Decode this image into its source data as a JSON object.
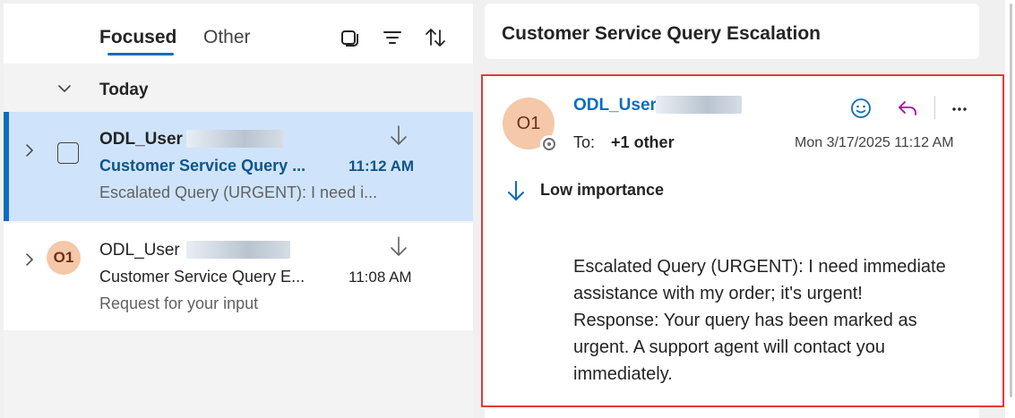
{
  "list": {
    "tabs": [
      {
        "label": "Focused"
      },
      {
        "label": "Other"
      }
    ],
    "icons": [
      "select-mode-icon",
      "filter-icon",
      "sort-icon"
    ],
    "group": {
      "label": "Today"
    },
    "messages": [
      {
        "sender": "ODL_User",
        "subject": "Customer Service Query ...",
        "time": "11:12 AM",
        "preview": "Escalated Query (URGENT): I need i...",
        "selected": true,
        "unread": true
      },
      {
        "sender": "ODL_User",
        "avatar": "O1",
        "subject": "Customer Service Query E...",
        "time": "11:08 AM",
        "preview": "Request for your input",
        "selected": false,
        "unread": false
      }
    ]
  },
  "reading": {
    "subject": "Customer Service Query Escalation",
    "avatar": "O1",
    "from": "ODL_User",
    "to_label": "To:",
    "to_other": "+1 other",
    "date": "Mon 3/17/2025 11:12 AM",
    "importance": "Low importance",
    "body": "Escalated Query (URGENT): I need immediate assistance with my order; it's urgent! Response: Your query has been marked as urgent. A support agent will contact you immediately.",
    "icons": [
      "emoji-react-icon",
      "reply-icon",
      "more-actions-icon"
    ]
  },
  "colors": {
    "accent": "#0f6cbd",
    "selected_row": "#cfe4fa",
    "avatar_bg": "#f4c8a8",
    "highlight_border": "#e03c3c",
    "reply_icon": "#b4009e"
  }
}
